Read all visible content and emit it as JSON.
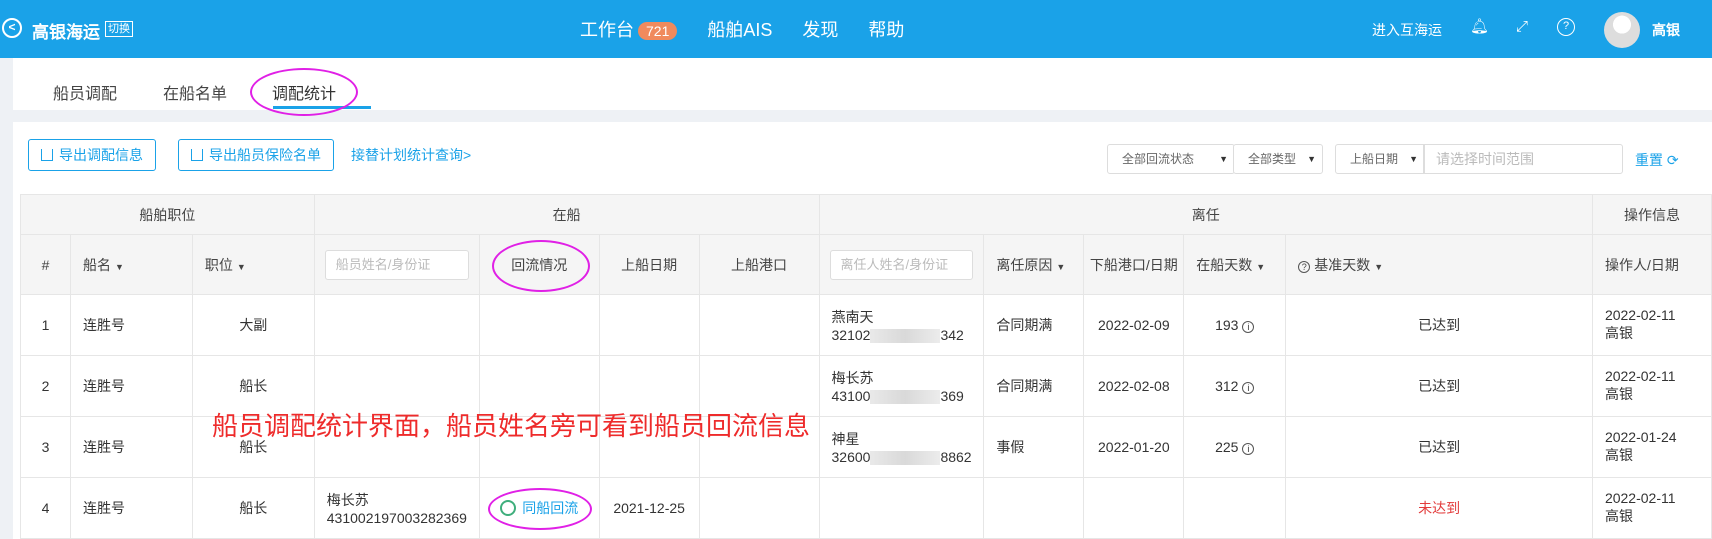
{
  "topbar": {
    "brand": "高银海运",
    "switch_label": "切换",
    "nav": [
      "工作台",
      "船舶AIS",
      "发现",
      "帮助"
    ],
    "workbench_badge": "721",
    "enter_label": "进入互海运",
    "user_name": "高银"
  },
  "tabs": [
    "船员调配",
    "在船名单",
    "调配统计"
  ],
  "toolbar": {
    "export_dispatch": "导出调配信息",
    "export_insurance": "导出船员保险名单",
    "replace_link": "接替计划统计查询>",
    "filter_reflow": "全部回流状态",
    "filter_type": "全部类型",
    "filter_date": "上船日期",
    "date_placeholder": "请选择时间范围",
    "reset": "重置"
  },
  "table": {
    "group_headers": [
      "船舶职位",
      "在船",
      "离任",
      "操作信息"
    ],
    "headers": {
      "index": "#",
      "ship": "船名",
      "position": "职位",
      "crew_placeholder": "船员姓名/身份证",
      "reflow": "回流情况",
      "board_date": "上船日期",
      "board_port": "上船港口",
      "leaver_placeholder": "离任人姓名/身份证",
      "leave_reason": "离任原因",
      "disembark": "下船港口/日期",
      "days_on_board": "在船天数",
      "base_days": "基准天数",
      "operator": "操作人/日期"
    },
    "rows": [
      {
        "idx": "1",
        "ship": "连胜号",
        "position": "大副",
        "crew_name": "",
        "crew_id": "",
        "reflow": "",
        "board_date": "",
        "leaver_name": "燕南天",
        "leaver_id_a": "32102",
        "leaver_id_b": "342",
        "reason": "合同期满",
        "date": "2022-02-09",
        "days": "193",
        "status": "已达到",
        "op_date": "2022-02-11",
        "op_user": "高银"
      },
      {
        "idx": "2",
        "ship": "连胜号",
        "position": "船长",
        "crew_name": "",
        "crew_id": "",
        "reflow": "",
        "board_date": "",
        "leaver_name": "梅长苏",
        "leaver_id_a": "43100",
        "leaver_id_b": "369",
        "reason": "合同期满",
        "date": "2022-02-08",
        "days": "312",
        "status": "已达到",
        "op_date": "2022-02-11",
        "op_user": "高银"
      },
      {
        "idx": "3",
        "ship": "连胜号",
        "position": "船长",
        "crew_name": "",
        "crew_id": "",
        "reflow": "",
        "board_date": "",
        "leaver_name": "神星",
        "leaver_id_a": "32600",
        "leaver_id_b": "8862",
        "reason": "事假",
        "date": "2022-01-20",
        "days": "225",
        "status": "已达到",
        "op_date": "2022-01-24",
        "op_user": "高银"
      },
      {
        "idx": "4",
        "ship": "连胜号",
        "position": "船长",
        "crew_name": "梅长苏",
        "crew_id": "431002197003282369",
        "reflow": "同船回流",
        "board_date": "2021-12-25",
        "leaver_name": "",
        "leaver_id_a": "",
        "leaver_id_b": "",
        "reason": "",
        "date": "",
        "days": "",
        "status": "未达到",
        "op_date": "2022-02-11",
        "op_user": "高银"
      }
    ]
  },
  "annotation": "船员调配统计界面，船员姓名旁可看到船员回流信息",
  "colors": {
    "primary": "#1aa2e8",
    "highlight": "#e020e6",
    "warning": "#e23b3b"
  }
}
